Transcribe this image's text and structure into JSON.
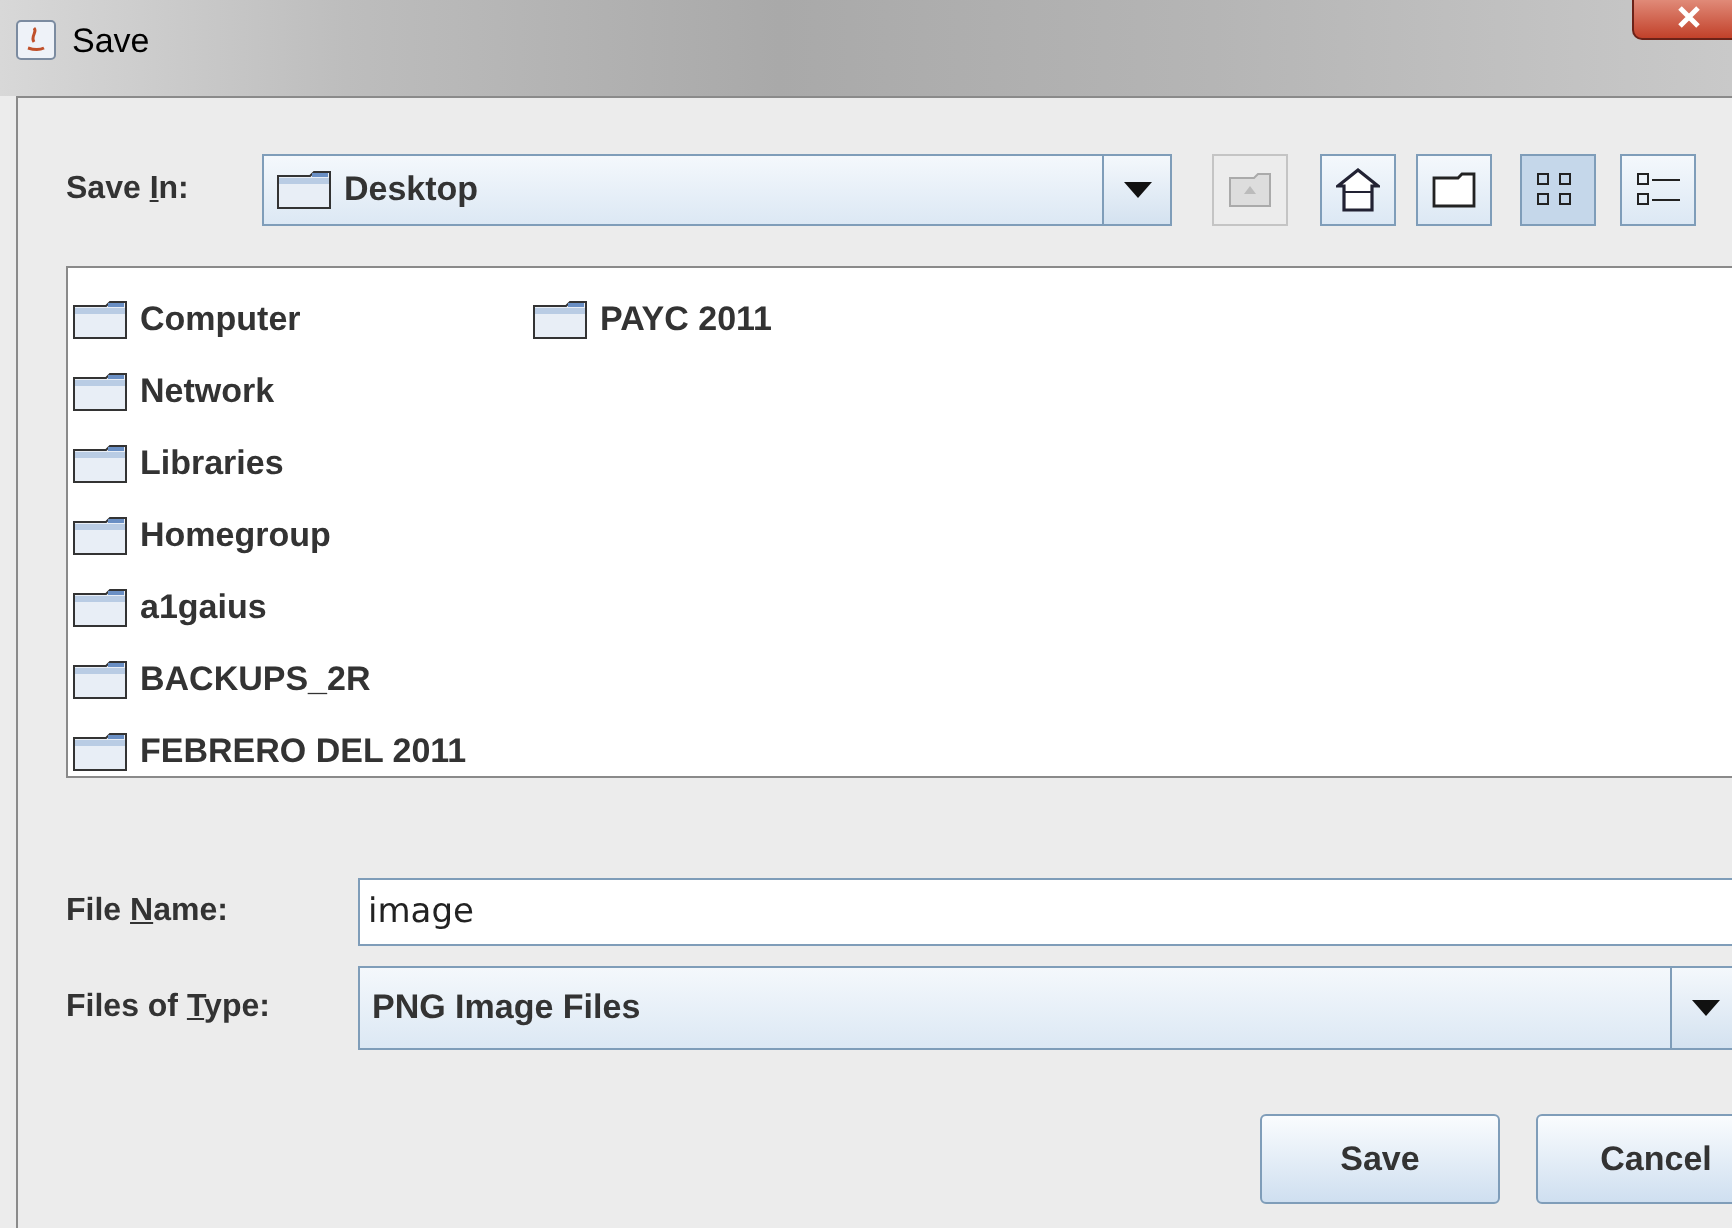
{
  "window": {
    "title": "Save"
  },
  "save_in": {
    "label": {
      "before": "Save ",
      "key": "I",
      "after": "n:"
    },
    "value": "Desktop"
  },
  "toolbar": [
    {
      "kind": "up",
      "disabled": true,
      "selected": false
    },
    {
      "kind": "home",
      "disabled": false,
      "selected": false
    },
    {
      "kind": "new-folder",
      "disabled": false,
      "selected": false
    },
    {
      "kind": "list",
      "disabled": false,
      "selected": true
    },
    {
      "kind": "details",
      "disabled": false,
      "selected": false
    }
  ],
  "files": [
    {
      "name": "Computer"
    },
    {
      "name": "Network"
    },
    {
      "name": "Libraries"
    },
    {
      "name": "Homegroup"
    },
    {
      "name": "a1gaius"
    },
    {
      "name": "BACKUPS_2R"
    },
    {
      "name": "FEBRERO DEL 2011"
    },
    {
      "name": "PAYC 2011"
    }
  ],
  "file_name": {
    "label": {
      "before": "File ",
      "key": "N",
      "after": "ame:"
    },
    "value": "image"
  },
  "file_type": {
    "label": {
      "before": "Files of ",
      "key": "T",
      "after": "ype:"
    },
    "value": "PNG Image Files"
  },
  "buttons": [
    "Save",
    "Cancel"
  ]
}
